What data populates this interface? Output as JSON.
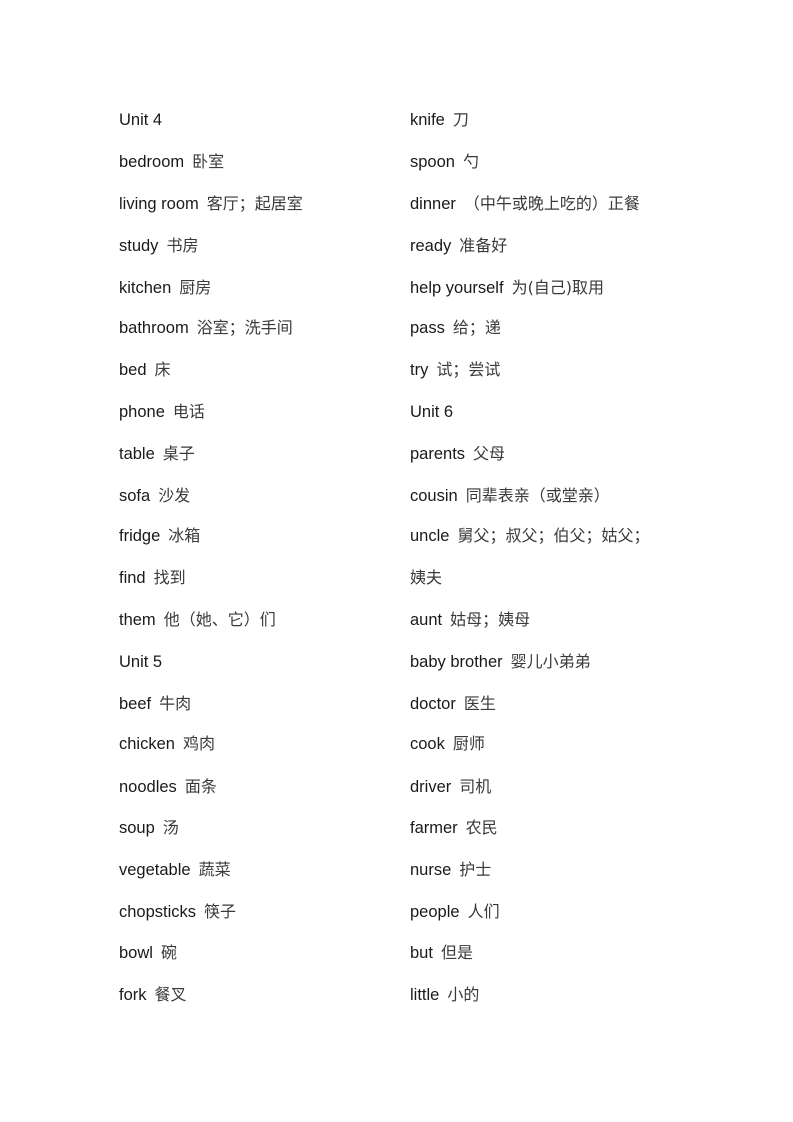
{
  "left": [
    {
      "type": "heading",
      "en": "Unit 4"
    },
    {
      "en": "bedroom",
      "zh": "卧室"
    },
    {
      "en": "living room",
      "zh": "客厅；起居室"
    },
    {
      "en": "study",
      "zh": "书房"
    },
    {
      "en": "kitchen",
      "zh": "厨房"
    },
    {
      "en": "bathroom",
      "zh": "浴室；洗手间"
    },
    {
      "en": "bed",
      "zh": "床"
    },
    {
      "en": "phone",
      "zh": "电话"
    },
    {
      "en": "table",
      "zh": "桌子"
    },
    {
      "en": "sofa",
      "zh": "沙发"
    },
    {
      "en": "fridge",
      "zh": "冰箱"
    },
    {
      "en": "find",
      "zh": "找到"
    },
    {
      "en": "them",
      "zh": "他（她、它）们"
    },
    {
      "type": "heading",
      "en": "Unit 5"
    },
    {
      "en": "beef",
      "zh": "牛肉"
    },
    {
      "en": "chicken",
      "zh": "鸡肉"
    },
    {
      "en": "noodles",
      "zh": "面条"
    },
    {
      "en": "soup",
      "zh": "汤"
    },
    {
      "en": "vegetable",
      "zh": "蔬菜"
    },
    {
      "en": "chopsticks",
      "zh": "筷子"
    },
    {
      "en": "bowl",
      "zh": "碗"
    },
    {
      "en": "fork",
      "zh": "餐叉"
    }
  ],
  "right": [
    {
      "en": "knife",
      "zh": "刀"
    },
    {
      "en": "spoon",
      "zh": "勺"
    },
    {
      "en": "dinner",
      "zh": "（中午或晚上吃的）正餐"
    },
    {
      "en": "ready",
      "zh": "准备好"
    },
    {
      "en": "help yourself",
      "zh": "为(自己)取用"
    },
    {
      "en": "pass",
      "zh": "给；递"
    },
    {
      "en": "try",
      "zh": "试；尝试"
    },
    {
      "type": "heading",
      "en": "Unit 6"
    },
    {
      "en": "parents",
      "zh": "父母"
    },
    {
      "en": "cousin",
      "zh": "同辈表亲（或堂亲）"
    },
    {
      "en": "uncle",
      "zh": "舅父；叔父；伯父；姑父；"
    },
    {
      "type": "continuation",
      "zh": "姨夫"
    },
    {
      "en": "aunt",
      "zh": "姑母；姨母"
    },
    {
      "en": "baby brother",
      "zh": "婴儿小弟弟"
    },
    {
      "en": "doctor",
      "zh": "医生"
    },
    {
      "en": "cook",
      "zh": "厨师"
    },
    {
      "en": "driver",
      "zh": "司机"
    },
    {
      "en": "farmer",
      "zh": "农民"
    },
    {
      "en": "nurse",
      "zh": "护士"
    },
    {
      "en": "people",
      "zh": "人们"
    },
    {
      "en": "but",
      "zh": "但是"
    },
    {
      "en": "little",
      "zh": "小的"
    }
  ]
}
